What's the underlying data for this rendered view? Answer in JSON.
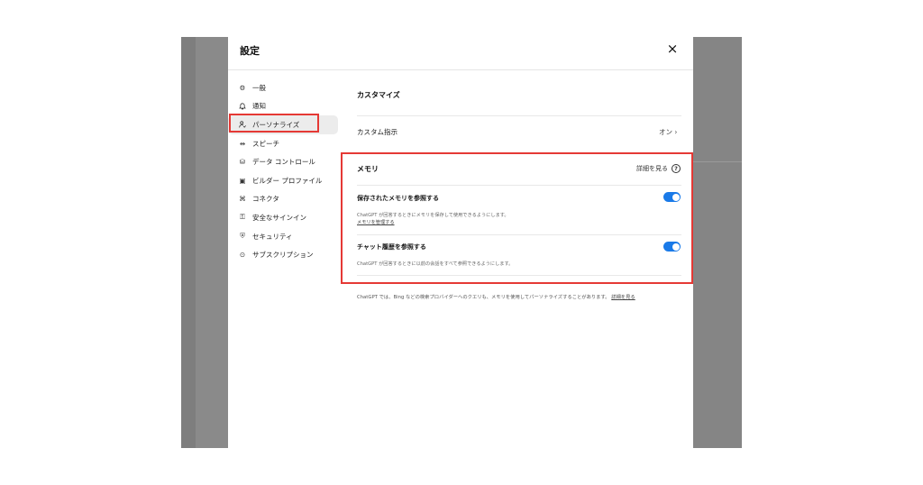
{
  "dialog": {
    "title": "設定",
    "close_label": "×"
  },
  "sidebar": {
    "items": [
      {
        "label": "一般",
        "icon": "gear-icon",
        "glyph": "⚙"
      },
      {
        "label": "通知",
        "icon": "bell-icon",
        "glyph": "🔔"
      },
      {
        "label": "パーソナライズ",
        "icon": "person-icon",
        "glyph": "♙"
      },
      {
        "label": "スピーチ",
        "icon": "speech-icon",
        "glyph": "⇹"
      },
      {
        "label": "データ コントロール",
        "icon": "data-control-icon",
        "glyph": "⛁"
      },
      {
        "label": "ビルダー プロファイル",
        "icon": "builder-profile-icon",
        "glyph": "▣"
      },
      {
        "label": "コネクタ",
        "icon": "connector-icon",
        "glyph": "⌘"
      },
      {
        "label": "安全なサインイン",
        "icon": "secure-signin-icon",
        "glyph": "⚿"
      },
      {
        "label": "セキュリティ",
        "icon": "shield-icon",
        "glyph": "⛨"
      },
      {
        "label": "サブスクリプション",
        "icon": "subscription-icon",
        "glyph": "⊙"
      }
    ],
    "active_index": 2
  },
  "customize": {
    "section_title": "カスタマイズ",
    "custom_instructions_label": "カスタム指示",
    "custom_instructions_value": "オン ›"
  },
  "memory": {
    "section_title": "メモリ",
    "learn_more": "詳細を見る",
    "saved_memory": {
      "title": "保存されたメモリを参照する",
      "description": "ChatGPT が回答するときにメモリを保存して使用できるようにします。",
      "link": "メモリを管理する",
      "enabled": true
    },
    "chat_history": {
      "title": "チャット履歴を参照する",
      "description": "ChatGPT が回答するときに以前の会話をすべて参照できるようにします。",
      "enabled": true
    }
  },
  "footer": {
    "note": "ChatGPT では、Bing などの検索プロバイダーへのクエリも、メモリを使用してパーソナライズすることがあります。",
    "link": "詳細を見る"
  },
  "colors": {
    "accent": "#1a7ae8",
    "highlight": "#e53935",
    "backdrop": "#8a8a8a"
  }
}
